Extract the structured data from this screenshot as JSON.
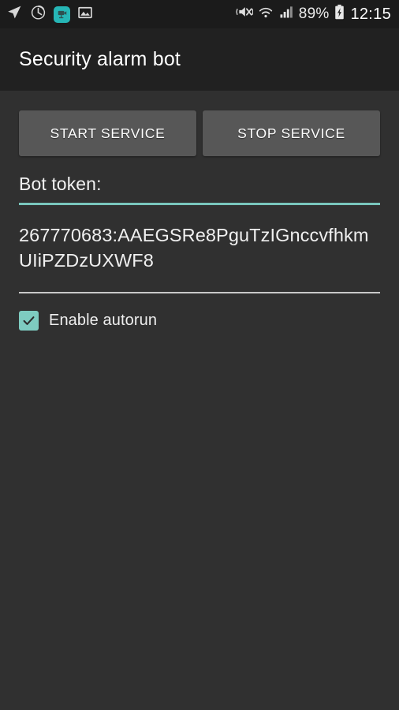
{
  "statusbar": {
    "left_icons": [
      {
        "name": "location-arrow-icon",
        "label": "location"
      },
      {
        "name": "alarm-clock-icon",
        "label": "alarm"
      },
      {
        "name": "app-notification-icon",
        "label": "app",
        "color": "#26b6b6"
      },
      {
        "name": "image-icon",
        "label": "screenshot"
      }
    ],
    "right_icons": [
      {
        "name": "volume-mute-vibrate-icon",
        "label": "vibrate"
      },
      {
        "name": "wifi-icon",
        "label": "wifi"
      },
      {
        "name": "cellular-signal-icon",
        "label": "signal"
      },
      {
        "name": "battery-charging-icon",
        "label": "battery charging"
      }
    ],
    "battery_percent": "89%",
    "clock": "12:15"
  },
  "header": {
    "title": "Security alarm bot"
  },
  "main": {
    "start_button": "START SERVICE",
    "stop_button": "STOP SERVICE",
    "token_field": {
      "label": "Bot token:",
      "value": "267770683:AAEGSRe8PguTzIGnccvfhkmUIiPZDzUXWF8",
      "accent_color": "#79c6bd"
    },
    "autorun": {
      "label": "Enable autorun",
      "checked": true,
      "checkbox_color": "#7ecbc0"
    }
  },
  "theme": {
    "statusbar_bg": "#1b1b1b",
    "titlebar_bg": "#212121",
    "content_bg": "#303030",
    "button_bg": "#575757",
    "accent": "#79c6bd",
    "text_primary": "#f0f0f0"
  }
}
